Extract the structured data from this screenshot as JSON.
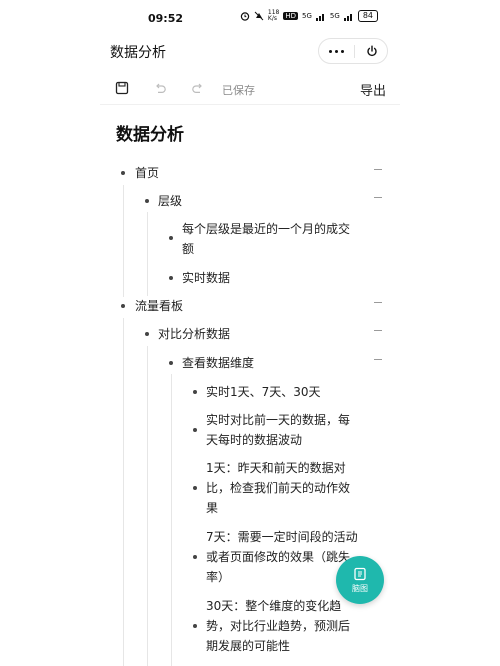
{
  "status_bar": {
    "time": "09:52",
    "net_speed": "118\nK/s",
    "hd_badge": "HD",
    "signal1": "5G",
    "signal2": "5G",
    "battery": "84"
  },
  "header": {
    "title": "数据分析",
    "more_icon": "more-dots-icon",
    "close_icon": "power-icon"
  },
  "toolbar": {
    "saved_label": "已保存",
    "export_label": "导出"
  },
  "document": {
    "title": "数据分析",
    "lines": [
      "首页",
      "层级",
      "每个层级是最近的一个月的成交",
      "额",
      "实时数据",
      "流量看板",
      "对比分析数据",
      "查看数据维度",
      "实时1天、7天、30天",
      "实时对比前一天的数据，每",
      "天每时的数据波动",
      "1天：昨天和前天的数据对",
      "比，检查我们前天的动作效",
      "果",
      "7天：需要一定时间段的活动",
      "或者页面修改的效果（跳失",
      "率）",
      "30天：整个维度的变化趋",
      "势，对比行业趋势，预测后",
      "期发展的可能性"
    ]
  },
  "fab": {
    "label": "脑图",
    "icon": "mindmap-icon"
  },
  "colors": {
    "accent": "#1fb8ad",
    "text": "#222222",
    "muted": "#8a8a8a"
  }
}
